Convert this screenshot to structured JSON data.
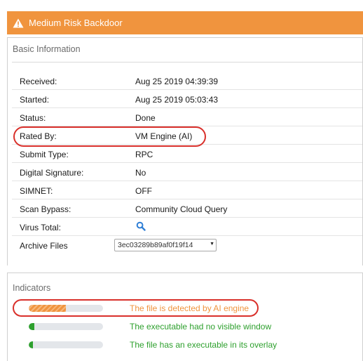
{
  "header": {
    "title": "Medium Risk Backdoor"
  },
  "basic": {
    "title": "Basic Information",
    "received": {
      "label": "Received:",
      "value": "Aug 25 2019 04:39:39"
    },
    "started": {
      "label": "Started:",
      "value": "Aug 25 2019 05:03:43"
    },
    "status": {
      "label": "Status:",
      "value": "Done"
    },
    "rated_by": {
      "label": "Rated By:",
      "value": "VM Engine (AI)"
    },
    "submit_type": {
      "label": "Submit Type:",
      "value": "RPC"
    },
    "digital_signature": {
      "label": "Digital Signature:",
      "value": "No"
    },
    "simnet": {
      "label": "SIMNET:",
      "value": "OFF"
    },
    "scan_bypass": {
      "label": "Scan Bypass:",
      "value": "Community Cloud Query"
    },
    "virus_total": {
      "label": "Virus Total:",
      "icon": "search-icon"
    },
    "archive_files": {
      "label": "Archive Files",
      "selected": "3ec03289b89af0f19f14"
    }
  },
  "indicators": {
    "title": "Indicators",
    "items": [
      {
        "text": "The file is detected by AI engine",
        "level": 0.5,
        "color": "#f0943e"
      },
      {
        "text": "The executable had no visible window",
        "level": 0.08,
        "color": "#2ea02e"
      },
      {
        "text": "The file has an executable in its overlay",
        "level": 0.05,
        "color": "#2ea02e"
      }
    ]
  },
  "colors": {
    "header_bg": "#f0943e",
    "highlight_oval": "#d9302b",
    "link_icon": "#2f7fd6"
  }
}
